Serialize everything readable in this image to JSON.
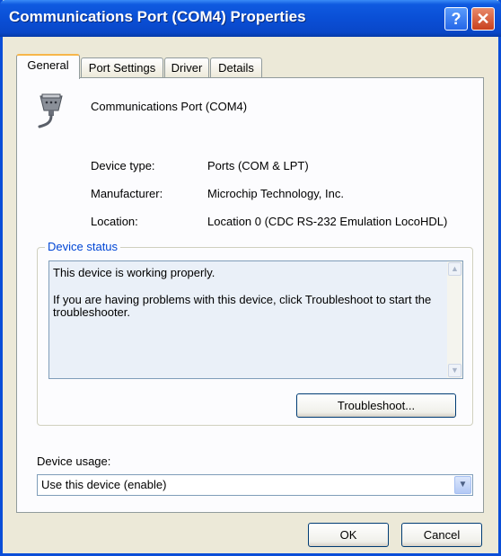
{
  "window": {
    "title": "Communications Port (COM4) Properties",
    "help_label": "?",
    "close_label": "✕"
  },
  "tabs": [
    {
      "label": "General",
      "active": true
    },
    {
      "label": "Port Settings",
      "active": false
    },
    {
      "label": "Driver",
      "active": false
    },
    {
      "label": "Details",
      "active": false
    }
  ],
  "device": {
    "icon": "serial-port-connector-icon",
    "name": "Communications Port (COM4)"
  },
  "properties": [
    {
      "label": "Device type:",
      "value": "Ports (COM & LPT)"
    },
    {
      "label": "Manufacturer:",
      "value": "Microchip Technology, Inc."
    },
    {
      "label": "Location:",
      "value": "Location 0 (CDC RS-232 Emulation LocoHDL)"
    }
  ],
  "status": {
    "legend": "Device status",
    "line1": "This device is working properly.",
    "line2": "If you are having problems with this device, click Troubleshoot to start the troubleshooter.",
    "troubleshoot_label": "Troubleshoot..."
  },
  "usage": {
    "label": "Device usage:",
    "selected": "Use this device (enable)"
  },
  "buttons": {
    "ok": "OK",
    "cancel": "Cancel"
  },
  "colors": {
    "titlebar": "#0a4fd6",
    "accent": "#0046d5",
    "dialog_bg": "#ece9d8"
  }
}
